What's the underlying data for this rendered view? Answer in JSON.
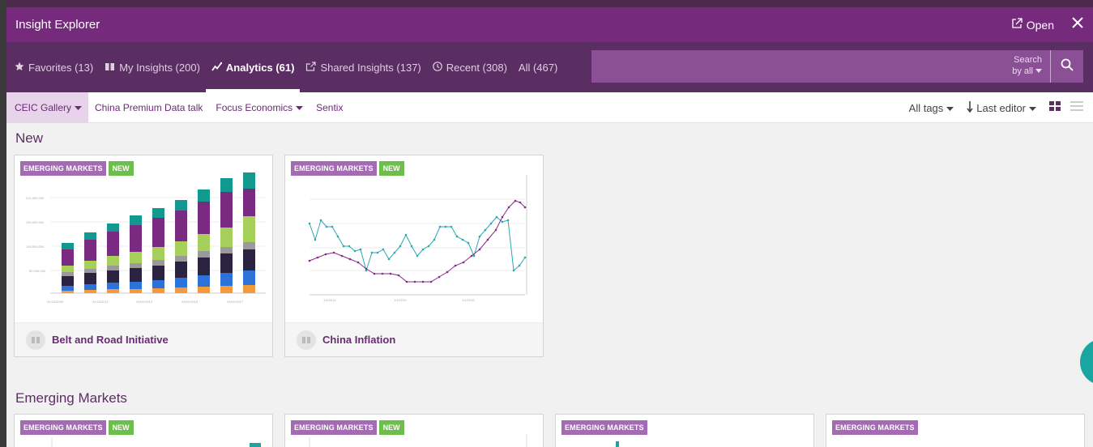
{
  "window": {
    "title": "Insight Explorer",
    "open_label": "Open"
  },
  "tabs": [
    {
      "label": "Favorites (13)",
      "icon": "star-icon"
    },
    {
      "label": "My Insights (200)",
      "icon": "book-icon"
    },
    {
      "label": "Analytics (61)",
      "icon": "trend-icon",
      "active": true
    },
    {
      "label": "Shared Insights (137)",
      "icon": "share-icon"
    },
    {
      "label": "Recent (308)",
      "icon": "clock-icon"
    },
    {
      "label": "All (467)",
      "icon": ""
    }
  ],
  "search": {
    "by_line1": "Search",
    "by_line2": "by all"
  },
  "subtabs": [
    {
      "label": "CEIC Gallery",
      "dropdown": true,
      "active": true
    },
    {
      "label": "China Premium Data talk",
      "dropdown": false
    },
    {
      "label": "Focus Economics",
      "dropdown": true
    },
    {
      "label": "Sentix",
      "dropdown": false
    }
  ],
  "filters": {
    "tags_label": "All tags",
    "sort_label": "Last editor"
  },
  "sections": [
    {
      "title": "New",
      "cards": [
        {
          "tag": "EMERGING MARKETS",
          "badge": "NEW",
          "name": "Belt and Road Initiative",
          "thumb": "stacked-bar"
        },
        {
          "tag": "EMERGING MARKETS",
          "badge": "NEW",
          "name": "China Inflation",
          "thumb": "dual-line"
        }
      ]
    },
    {
      "title": "Emerging Markets",
      "cards": [
        {
          "tag": "EMERGING MARKETS",
          "badge": "NEW"
        },
        {
          "tag": "EMERGING MARKETS",
          "badge": "NEW"
        },
        {
          "tag": "EMERGING MARKETS",
          "badge": ""
        },
        {
          "tag": "EMERGING MARKETS",
          "badge": ""
        }
      ]
    }
  ],
  "colors": {
    "titlebar": "#752a7c",
    "tabbar": "#5b2e63",
    "tag": "#a46ab3",
    "new_badge": "#6cbf4a",
    "accent_teal": "#1aa6a0"
  }
}
